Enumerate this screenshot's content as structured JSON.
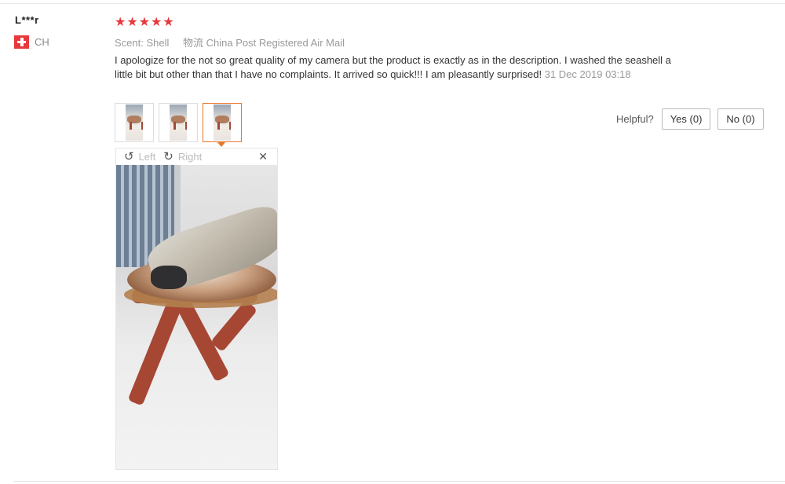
{
  "review": {
    "user_name": "L***r",
    "country_code": "CH",
    "rating_stars": "★★★★★",
    "rating": 5,
    "sku_label": "Scent:",
    "sku_value": "Shell",
    "shipping_label": "物流",
    "shipping_value": "China Post Registered Air Mail",
    "text": "I apologize for the not so great quality of my camera but the product is exactly as in the description. I washed the seashell a little bit but other than that I have no complaints. It arrived so quick!!! I am pleasantly surprised!",
    "date": "31 Dec 2019 03:18"
  },
  "helpful": {
    "label": "Helpful?",
    "yes_label": "Yes (0)",
    "no_label": "No (0)"
  },
  "viewer": {
    "rotate_left_label": "Left",
    "rotate_right_label": "Right",
    "close_glyph": "✕",
    "selected_thumbnail": 3
  },
  "icons": {
    "rotate_left": "↺",
    "rotate_right": "↻"
  },
  "colors": {
    "star": "#e8383b",
    "active_border": "#e8782c"
  }
}
